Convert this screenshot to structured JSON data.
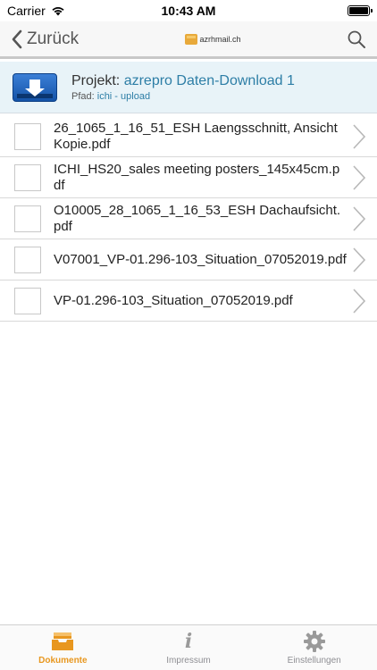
{
  "status_bar": {
    "carrier": "Carrier",
    "time": "10:43 AM"
  },
  "nav": {
    "back_label": "Zurück",
    "logo_text": "azrhmail.ch"
  },
  "project": {
    "label": "Projekt:",
    "name": "azrepro Daten-Download 1",
    "path_label": "Pfad:",
    "path_value": "ichi - upload",
    "icon": "download-icon"
  },
  "files": [
    {
      "name": "26_1065_1_16_51_ESH Laengsschnitt, Ansicht Kopie.pdf"
    },
    {
      "name": "ICHI_HS20_sales meeting posters_145x45cm.pdf"
    },
    {
      "name": "O10005_28_1065_1_16_53_ESH Dachaufsicht.pdf"
    },
    {
      "name": "V07001_VP-01.296-103_Situation_07052019.pdf"
    },
    {
      "name": "VP-01.296-103_Situation_07052019.pdf"
    }
  ],
  "tabs": [
    {
      "label": "Dokumente",
      "icon": "tray-icon",
      "active": true
    },
    {
      "label": "Impressum",
      "icon": "info-icon",
      "active": false
    },
    {
      "label": "Einstellungen",
      "icon": "gear-icon",
      "active": false
    }
  ],
  "colors": {
    "accent": "#e8971f",
    "link": "#2d7ea6",
    "header_bg": "#e8f3f8"
  }
}
